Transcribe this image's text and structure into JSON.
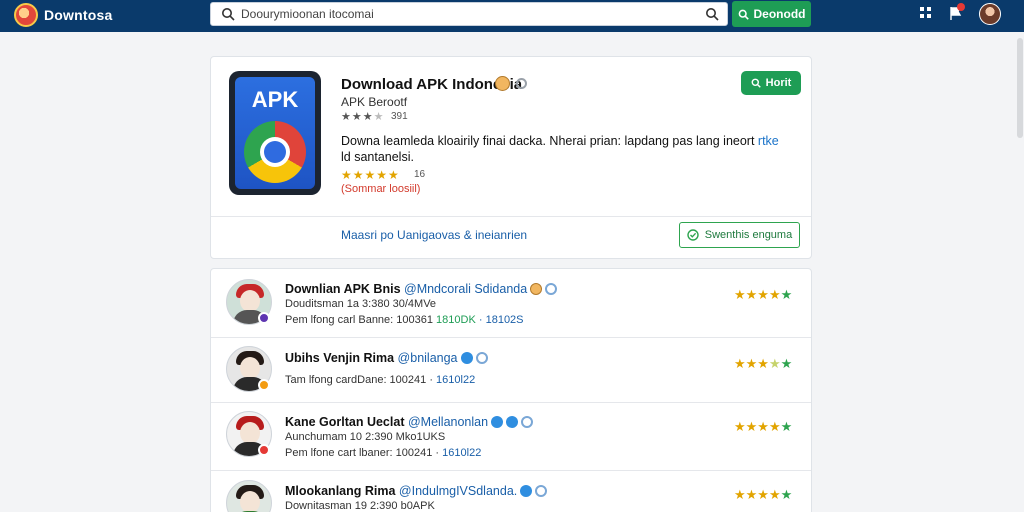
{
  "header": {
    "brand": "Downtosa",
    "search_placeholder": "Doourymioonan itocomai",
    "download_button": "Deonodd"
  },
  "app": {
    "title": "Download APK Indonesia",
    "icon_text": "APK",
    "subtitle": "APK Berootf",
    "small_count": "391",
    "description": "Downa leamleda kloairily finai dacka. Nherai prian: lapdang pas lang ineort ",
    "description_link": "rtke",
    "description_end": " ld santanelsi.",
    "rating_count": "16",
    "red_note": "(Sommar loosiil)",
    "host_button": "Horit",
    "more_link": "Maasri po Uanigaovas & ineianrien",
    "outline_button": "Swenthis enguma"
  },
  "list": [
    {
      "name": "Downlian APK Bnis",
      "handle": "@Mndcorali Sdidanda",
      "line2": "Douditsman 1a 3:380 30/4MVe",
      "line3_prefix": "Pem lfong carl Banne: 100361 ",
      "line3_green": "1810DK",
      "line3_suffix": " · 18102S",
      "stars": "★★★★",
      "star_last": "★"
    },
    {
      "name": "Ubihs Venjin Rima",
      "handle": "@bnilanga",
      "line2": "",
      "line3_prefix": "Tam lfong cardDane: 100241 · ",
      "line3_green": "",
      "line3_suffix": "1610l22",
      "stars": "★★★",
      "star_last": "★"
    },
    {
      "name": "Kane Gorltan Ueclat",
      "handle": "@Mellanonlan",
      "line2": "Aunchumam 10 2:390 Mko1UKS",
      "line3_prefix": "Pem lfone cart lbaner: 100241 · ",
      "line3_green": "",
      "line3_suffix": "1610l22",
      "stars": "★★★★",
      "star_last": "★"
    },
    {
      "name": "Mlookanlang Rima",
      "handle": "@IndulmgIVSdlanda.",
      "line2": "Downitasman 19 2:390 b0APK",
      "line3_prefix": "",
      "line3_green": "",
      "line3_suffix": "",
      "stars": "★★★★",
      "star_last": "★"
    }
  ],
  "colors": {
    "header_bg": "#0a3a6b",
    "accent_green": "#1e9d55",
    "link_blue": "#1a5fa8",
    "star_gold": "#e2a400"
  }
}
